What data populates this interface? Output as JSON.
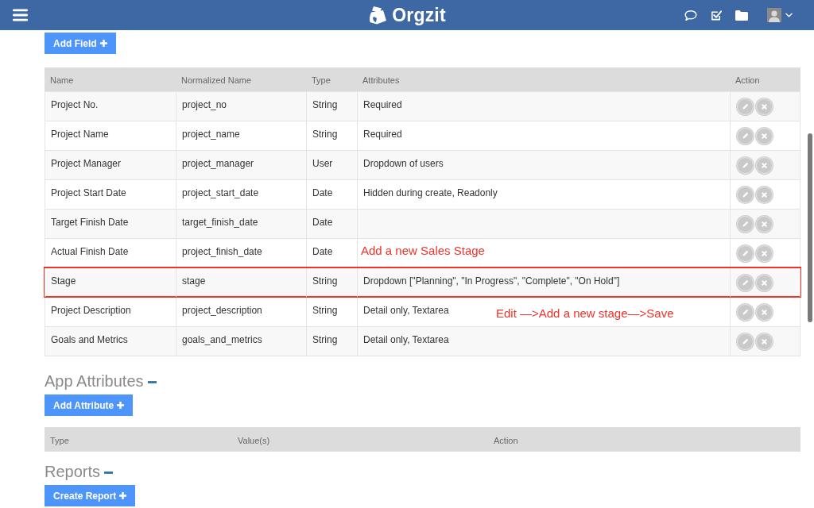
{
  "app_bar": {
    "logo_text": "Orgzit"
  },
  "fields": {
    "add_button": "Add Field",
    "columns": [
      "Name",
      "Normalized Name",
      "Type",
      "Attributes",
      "Action"
    ],
    "rows": [
      {
        "name": "Project No.",
        "normalized_name": "project_no",
        "type": "String",
        "attributes": "Required",
        "highlighted": false
      },
      {
        "name": "Project Name",
        "normalized_name": "project_name",
        "type": "String",
        "attributes": "Required",
        "highlighted": false
      },
      {
        "name": "Project Manager",
        "normalized_name": "project_manager",
        "type": "User",
        "attributes": "Dropdown of users",
        "highlighted": false
      },
      {
        "name": "Project Start Date",
        "normalized_name": "project_start_date",
        "type": "Date",
        "attributes": "Hidden during create, Readonly",
        "highlighted": false
      },
      {
        "name": "Target Finish Date",
        "normalized_name": "target_finish_date",
        "type": "Date",
        "highlighted": false
      },
      {
        "name": "Actual Finish Date",
        "normalized_name": "project_finish_date",
        "type": "Date",
        "annotation": "Add a new Sales Stage",
        "highlighted": false
      },
      {
        "name": "Stage",
        "normalized_name": "stage",
        "type": "String",
        "attributes": "Dropdown [\"Planning\", \"In Progress\", \"Complete\", \"On Hold\"]",
        "highlighted": true
      },
      {
        "name": "Project Description",
        "normalized_name": "project_description",
        "type": "String",
        "attributes": "Detail only, Textarea",
        "annotation": "Edit —>Add a new stage—>Save",
        "highlighted": false
      },
      {
        "name": "Goals and Metrics",
        "normalized_name": "goals_and_metrics",
        "type": "String",
        "attributes": "Detail only, Textarea",
        "highlighted": false
      }
    ]
  },
  "app_attributes": {
    "title": "App Attributes",
    "expanded": true,
    "add_button": "Add Attribute",
    "columns": [
      "Type",
      "Value(s)",
      "Action"
    ]
  },
  "reports": {
    "title": "Reports",
    "expanded": true,
    "create_button": "Create Report"
  }
}
